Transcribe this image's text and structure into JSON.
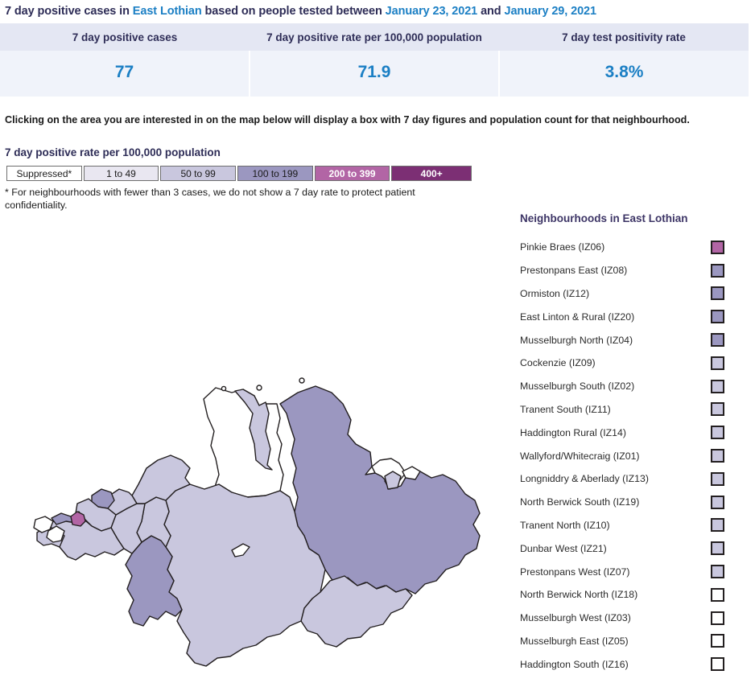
{
  "header": {
    "title_part1": "7 day positive cases in ",
    "area": "East Lothian",
    "title_part2": " based on people tested between ",
    "date_start": "January 23, 2021",
    "title_part3": " and ",
    "date_end": "January 29, 2021"
  },
  "stats": {
    "columns": [
      {
        "label": "7 day positive cases",
        "value": "77"
      },
      {
        "label": "7 day positive rate per 100,000 population",
        "value": "71.9"
      },
      {
        "label": "7 day test positivity rate",
        "value": "3.8%"
      }
    ]
  },
  "intro_note": "Clicking on the area you are interested in on the map below will display a box with 7 day figures and population count for that neighbourhood.",
  "legend": {
    "title": "7 day positive rate per 100,000 population",
    "bands": [
      {
        "label": "Suppressed*",
        "color": "#ffffff"
      },
      {
        "label": "1 to 49",
        "color": "#e9e7f1"
      },
      {
        "label": "50 to 99",
        "color": "#c9c7de"
      },
      {
        "label": "100 to 199",
        "color": "#9b97c0"
      },
      {
        "label": "200 to 399",
        "color": "#b265a5"
      },
      {
        "label": "400+",
        "color": "#7c2f74"
      }
    ],
    "footnote": "* For neighbourhoods with fewer than 3 cases, we do not show a 7 day rate to protect patient confidentiality."
  },
  "neighbourhoods": {
    "heading": "Neighbourhoods in East Lothian",
    "items": [
      {
        "label": "Pinkie Braes (IZ06)",
        "color": "#b265a5"
      },
      {
        "label": "Prestonpans East (IZ08)",
        "color": "#9b97c0"
      },
      {
        "label": "Ormiston (IZ12)",
        "color": "#9b97c0"
      },
      {
        "label": "East Linton & Rural (IZ20)",
        "color": "#9b97c0"
      },
      {
        "label": "Musselburgh North (IZ04)",
        "color": "#9b97c0"
      },
      {
        "label": "Cockenzie (IZ09)",
        "color": "#c9c7de"
      },
      {
        "label": "Musselburgh South (IZ02)",
        "color": "#c9c7de"
      },
      {
        "label": "Tranent South (IZ11)",
        "color": "#c9c7de"
      },
      {
        "label": "Haddington Rural (IZ14)",
        "color": "#c9c7de"
      },
      {
        "label": "Wallyford/Whitecraig (IZ01)",
        "color": "#c9c7de"
      },
      {
        "label": "Longniddry & Aberlady (IZ13)",
        "color": "#c9c7de"
      },
      {
        "label": "North Berwick South (IZ19)",
        "color": "#c9c7de"
      },
      {
        "label": "Tranent North (IZ10)",
        "color": "#c9c7de"
      },
      {
        "label": "Dunbar West (IZ21)",
        "color": "#c9c7de"
      },
      {
        "label": "Prestonpans West (IZ07)",
        "color": "#c9c7de"
      },
      {
        "label": "North Berwick North (IZ18)",
        "color": "#ffffff"
      },
      {
        "label": "Musselburgh West (IZ03)",
        "color": "#ffffff"
      },
      {
        "label": "Musselburgh East (IZ05)",
        "color": "#ffffff"
      },
      {
        "label": "Haddington South (IZ16)",
        "color": "#ffffff"
      }
    ]
  },
  "map": {
    "name": "east-lothian-choropleth",
    "outline_color": "#231f20",
    "regions": [
      {
        "name": "haddington-north-suppressed",
        "color": "#ffffff"
      },
      {
        "name": "east-linton-rural",
        "color": "#9b97c0"
      },
      {
        "name": "north-berwick-south",
        "color": "#c9c7de"
      },
      {
        "name": "north-berwick-north",
        "color": "#ffffff"
      },
      {
        "name": "dunbar-west",
        "color": "#c9c7de"
      },
      {
        "name": "haddington-south",
        "color": "#ffffff"
      },
      {
        "name": "haddington-rural",
        "color": "#c9c7de"
      },
      {
        "name": "ormiston",
        "color": "#9b97c0"
      },
      {
        "name": "tranent-south",
        "color": "#c9c7de"
      },
      {
        "name": "tranent-north",
        "color": "#c9c7de"
      },
      {
        "name": "longniddry-aberlady",
        "color": "#c9c7de"
      },
      {
        "name": "cockenzie",
        "color": "#c9c7de"
      },
      {
        "name": "prestonpans-east",
        "color": "#9b97c0"
      },
      {
        "name": "prestonpans-west",
        "color": "#c9c7de"
      },
      {
        "name": "wallyford-whitecraig",
        "color": "#c9c7de"
      },
      {
        "name": "musselburgh-north",
        "color": "#9b97c0"
      },
      {
        "name": "musselburgh-south",
        "color": "#c9c7de"
      },
      {
        "name": "musselburgh-east",
        "color": "#ffffff"
      },
      {
        "name": "musselburgh-west",
        "color": "#ffffff"
      },
      {
        "name": "pinkie-braes",
        "color": "#b265a5"
      }
    ]
  }
}
